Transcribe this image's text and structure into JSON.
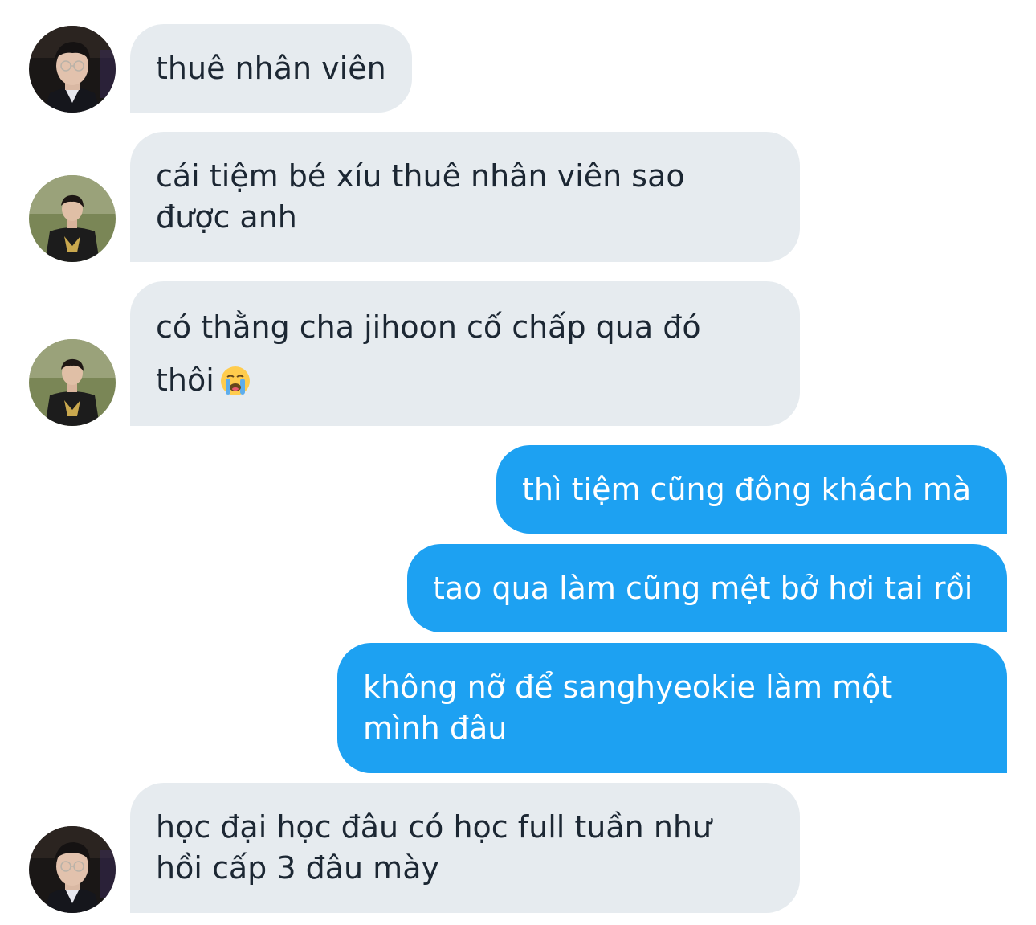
{
  "messages": [
    {
      "id": "m1",
      "side": "incoming",
      "text": "thuê nhân viên",
      "avatar": "avatar-glasses"
    },
    {
      "id": "m2",
      "side": "incoming",
      "text": "cái tiệm bé xíu thuê nhân viên sao\nđược anh",
      "avatar": "avatar-jersey"
    },
    {
      "id": "m3",
      "side": "incoming",
      "text": "có thằng cha jihoon cố chấp qua đó\nthôi",
      "emoji": "loudly-crying-face-emoji",
      "avatar": "avatar-jersey"
    },
    {
      "id": "m4",
      "side": "outgoing",
      "text": "thì tiệm cũng đông khách mà"
    },
    {
      "id": "m5",
      "side": "outgoing",
      "text": "tao qua làm cũng mệt bở hơi tai rồi"
    },
    {
      "id": "m6",
      "side": "outgoing",
      "text": "không nỡ để sanghyeokie làm một\nmình đâu"
    },
    {
      "id": "m7",
      "side": "incoming",
      "text": "học đại học đâu có học full tuần như\nhồi cấp 3 đâu mày",
      "avatar": "avatar-glasses"
    }
  ],
  "colors": {
    "incoming_bubble": "#e6ebef",
    "incoming_text": "#1c2733",
    "outgoing_bubble": "#1da1f2",
    "outgoing_text": "#ffffff"
  }
}
